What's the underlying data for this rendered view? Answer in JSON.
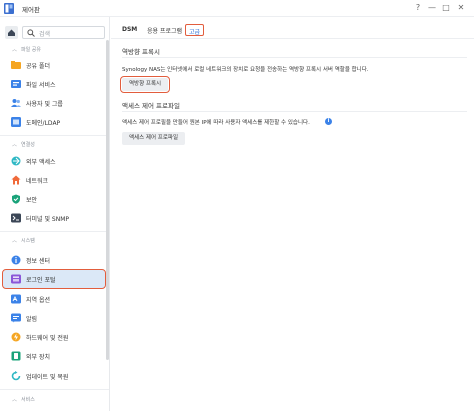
{
  "window": {
    "title": "제어판",
    "help": "?",
    "minimize": "—",
    "maximize": "□",
    "close": "✕"
  },
  "sidebar": {
    "search_placeholder": "검색",
    "sections": [
      {
        "label": "파일 공유",
        "items": [
          {
            "label": "공유 폴더",
            "icon": "shared-folder-icon",
            "color": "#f5a623"
          },
          {
            "label": "파일 서비스",
            "icon": "file-services-icon",
            "color": "#3b82e8"
          },
          {
            "label": "사용자 및 그룹",
            "icon": "user-group-icon",
            "color": "#3b82e8"
          },
          {
            "label": "도메인/LDAP",
            "icon": "domain-ldap-icon",
            "color": "#3b82e8"
          }
        ]
      },
      {
        "label": "연결성",
        "items": [
          {
            "label": "외부 액세스",
            "icon": "external-access-icon",
            "color": "#2fb8c4"
          },
          {
            "label": "네트워크",
            "icon": "network-icon",
            "color": "#f06a3a"
          },
          {
            "label": "보안",
            "icon": "security-shield-icon",
            "color": "#1aa37a"
          },
          {
            "label": "터미널 및 SNMP",
            "icon": "terminal-icon",
            "color": "#3b4656"
          }
        ]
      },
      {
        "label": "시스템",
        "items": [
          {
            "label": "정보 센터",
            "icon": "info-center-icon",
            "color": "#3b82e8"
          },
          {
            "label": "로그인 포털",
            "icon": "login-portal-icon",
            "color": "#8a56d8",
            "active": true
          },
          {
            "label": "지역 옵션",
            "icon": "regional-options-icon",
            "color": "#3b82e8"
          },
          {
            "label": "알림",
            "icon": "notification-icon",
            "color": "#3b82e8"
          },
          {
            "label": "하드웨어 및 전원",
            "icon": "hardware-power-icon",
            "color": "#f5a623"
          },
          {
            "label": "외부 장치",
            "icon": "external-devices-icon",
            "color": "#1aa37a"
          },
          {
            "label": "업데이트 및 복원",
            "icon": "update-restore-icon",
            "color": "#2fb8c4"
          }
        ]
      },
      {
        "label": "서비스",
        "items": []
      }
    ]
  },
  "tabs": [
    {
      "label": "DSM"
    },
    {
      "label": "응용 프로그램"
    },
    {
      "label": "고급"
    }
  ],
  "reverse_proxy": {
    "title": "역방향 프록시",
    "description": "Synology NAS는 인터넷에서 로컬 네트워크의 장치로 요청을 전송하는 역방향 프록시 서버 역할을 합니다.",
    "button": "역방향 프록시"
  },
  "access_control": {
    "title": "액세스 제어 프로파일",
    "description": "액세스 제어 프로필을 만들어 원본 IP에 따라 사용자 액세스를 제한할 수 있습니다.",
    "button": "액세스 제어 프로파일"
  }
}
